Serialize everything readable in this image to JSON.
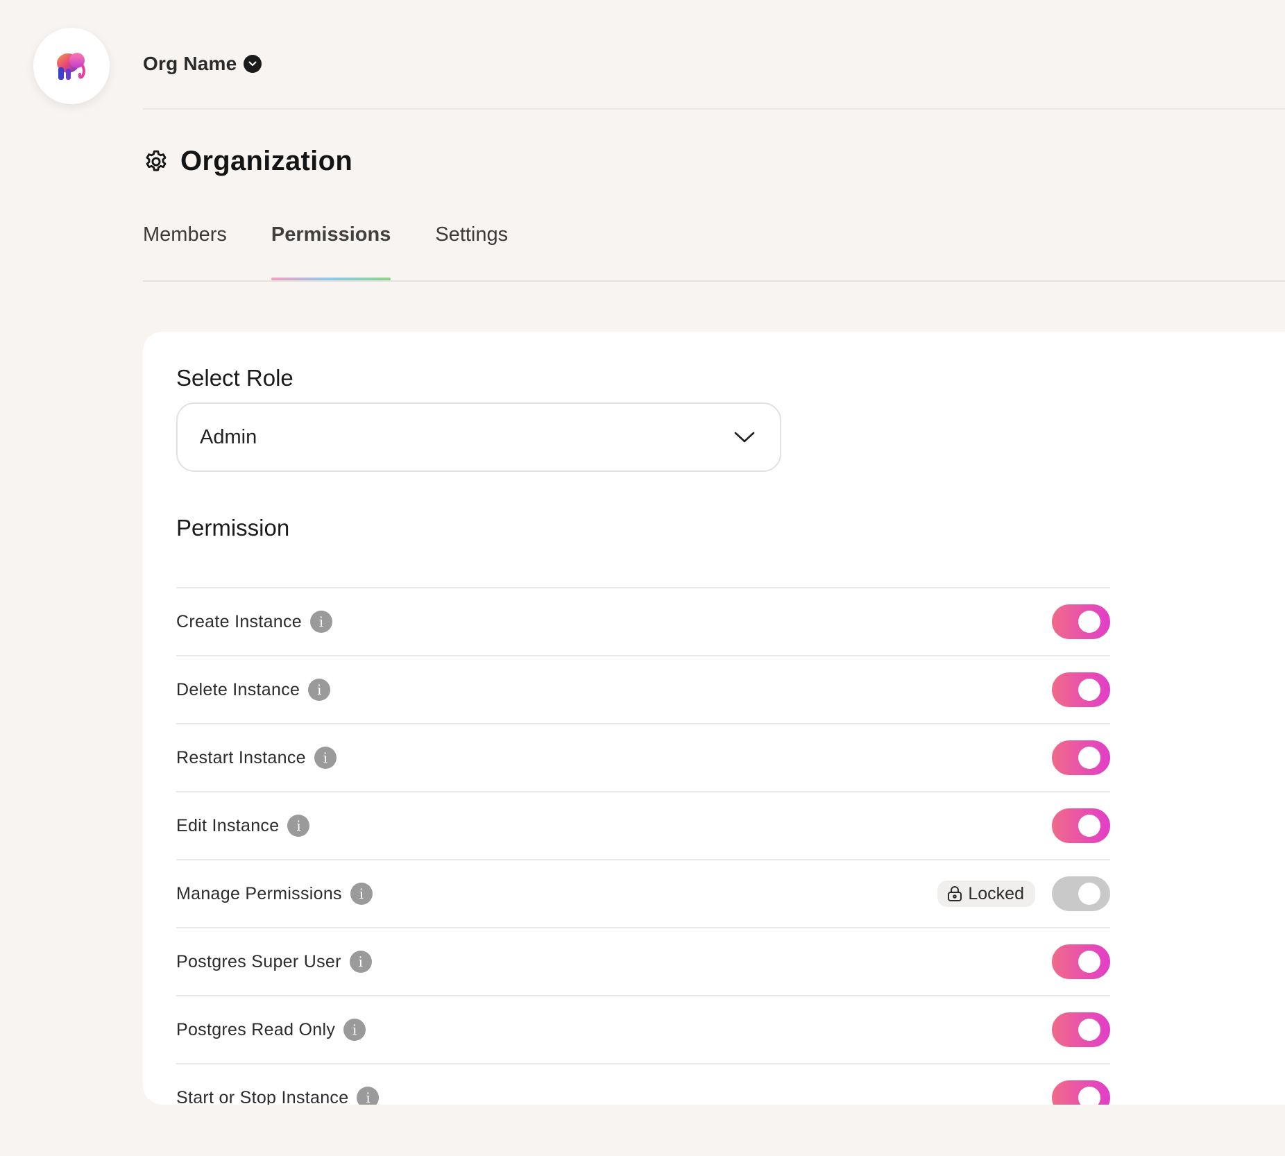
{
  "header": {
    "org_name": "Org Name",
    "logo_icon": "elephant-logo-icon",
    "caret_icon": "chevron-down-icon"
  },
  "page": {
    "title": "Organization",
    "title_icon": "gear-icon"
  },
  "tabs": [
    {
      "label": "Members",
      "active": false
    },
    {
      "label": "Permissions",
      "active": true
    },
    {
      "label": "Settings",
      "active": false
    }
  ],
  "role_select": {
    "label": "Select Role",
    "value": "Admin"
  },
  "permissions": {
    "heading": "Permission",
    "items": [
      {
        "label": "Create Instance",
        "enabled": true,
        "locked": false
      },
      {
        "label": "Delete Instance",
        "enabled": true,
        "locked": false
      },
      {
        "label": "Restart Instance",
        "enabled": true,
        "locked": false
      },
      {
        "label": "Edit Instance",
        "enabled": true,
        "locked": false
      },
      {
        "label": "Manage Permissions",
        "enabled": false,
        "locked": true,
        "locked_label": "Locked"
      },
      {
        "label": "Postgres Super User",
        "enabled": true,
        "locked": false
      },
      {
        "label": "Postgres Read Only",
        "enabled": true,
        "locked": false
      },
      {
        "label": "Start or Stop Instance",
        "enabled": true,
        "locked": false
      }
    ]
  },
  "colors": {
    "toggle_on_start": "#f06a8a",
    "toggle_on_end": "#e03ec8",
    "toggle_off": "#c9c9c9",
    "background": "#f7f4f1"
  }
}
